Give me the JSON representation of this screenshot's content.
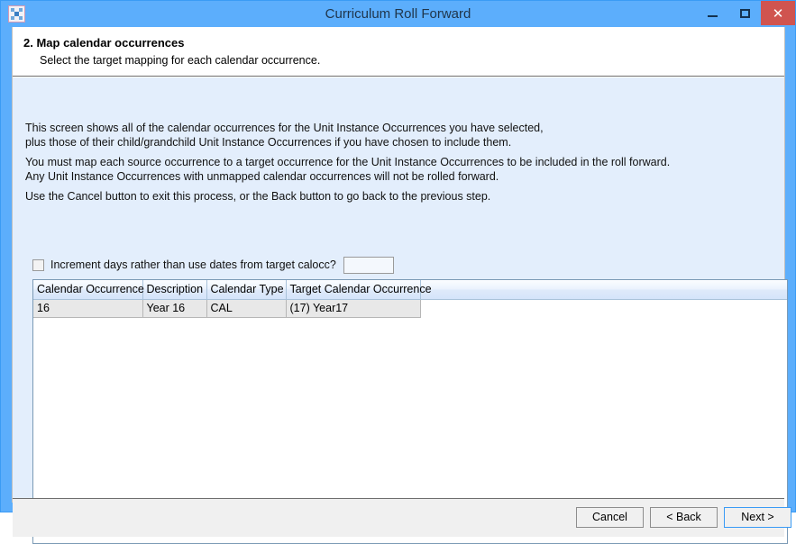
{
  "window": {
    "title": "Curriculum Roll Forward",
    "icon": "app-icon",
    "controls": {
      "minimize": "minimize-icon",
      "maximize": "maximize-icon",
      "close": "✕"
    },
    "accent": "#5caefc",
    "close_color": "#d0544f"
  },
  "header": {
    "step_title": "2. Map calendar occurrences",
    "step_subtitle": "Select the target mapping for each calendar occurrence."
  },
  "instructions": {
    "line1": "This screen shows all of the calendar occurrences for the Unit Instance Occurrences you have selected,",
    "line2": "plus those of their child/grandchild Unit Instance Occurrences if you have chosen to include them.",
    "line3": "You must map each source occurrence to a target occurrence for the Unit Instance Occurrences to be included in the roll forward.",
    "line4": "Any Unit Instance Occurrences with unmapped calendar occurrences will not be rolled forward.",
    "line5": "Use the Cancel button to exit this process, or the Back button to go back to the previous step."
  },
  "options": {
    "increment_days_label": "Increment days rather than use dates from target calocc?",
    "increment_days_checked": false,
    "increment_days_value": "",
    "increment_days_placeholder": ""
  },
  "grid": {
    "columns": [
      "Calendar Occurrence",
      "Description",
      "Calendar Type",
      "Target Calendar Occurrence"
    ],
    "rows": [
      {
        "calendar_occurrence": "16",
        "description": "Year 16",
        "calendar_type": "CAL",
        "target_calendar_occurrence": "(17) Year17"
      }
    ]
  },
  "footer": {
    "cancel": "Cancel",
    "back": "< Back",
    "next": "Next >"
  }
}
